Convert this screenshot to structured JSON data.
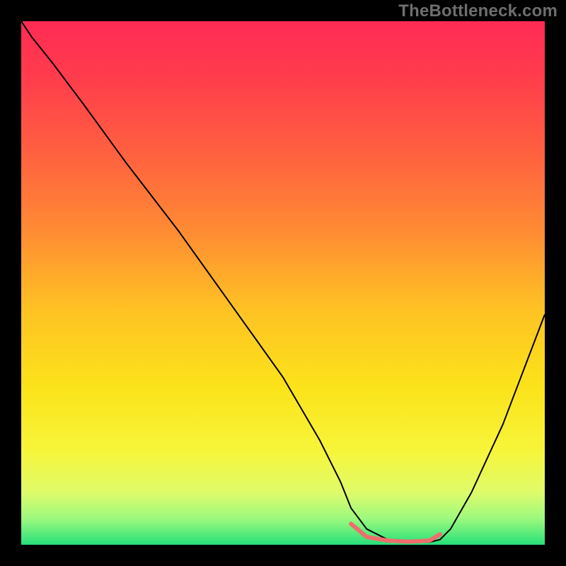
{
  "watermark": "TheBottleneck.com",
  "chart_data": {
    "type": "line",
    "title": "",
    "xlabel": "",
    "ylabel": "",
    "xlim": [
      0,
      100
    ],
    "ylim": [
      0,
      100
    ],
    "background_gradient": {
      "stops": [
        {
          "offset": 0.0,
          "color": "#ff2b55"
        },
        {
          "offset": 0.1,
          "color": "#ff3b4d"
        },
        {
          "offset": 0.25,
          "color": "#ff6040"
        },
        {
          "offset": 0.4,
          "color": "#ff8b33"
        },
        {
          "offset": 0.55,
          "color": "#ffc224"
        },
        {
          "offset": 0.7,
          "color": "#fbe31a"
        },
        {
          "offset": 0.82,
          "color": "#f7f53a"
        },
        {
          "offset": 0.9,
          "color": "#dffb6a"
        },
        {
          "offset": 0.95,
          "color": "#9cf97e"
        },
        {
          "offset": 1.0,
          "color": "#27e07a"
        }
      ]
    },
    "series": [
      {
        "name": "bottleneck-curve",
        "color": "#000000",
        "width": 2,
        "x": [
          0,
          2,
          6,
          12,
          20,
          30,
          40,
          50,
          57,
          61,
          63,
          66,
          70,
          74,
          78,
          80,
          82,
          86,
          92,
          100
        ],
        "y": [
          100,
          97,
          92,
          84,
          73,
          60,
          46,
          32,
          20,
          12,
          7,
          3,
          1,
          0.5,
          0.5,
          1,
          3,
          10,
          23,
          44
        ]
      }
    ],
    "valley_marker": {
      "color": "#ef6e6c",
      "width": 6,
      "x": [
        63,
        66,
        70,
        74,
        78,
        80
      ],
      "y": [
        4,
        1.5,
        0.8,
        0.6,
        0.8,
        2
      ]
    }
  }
}
